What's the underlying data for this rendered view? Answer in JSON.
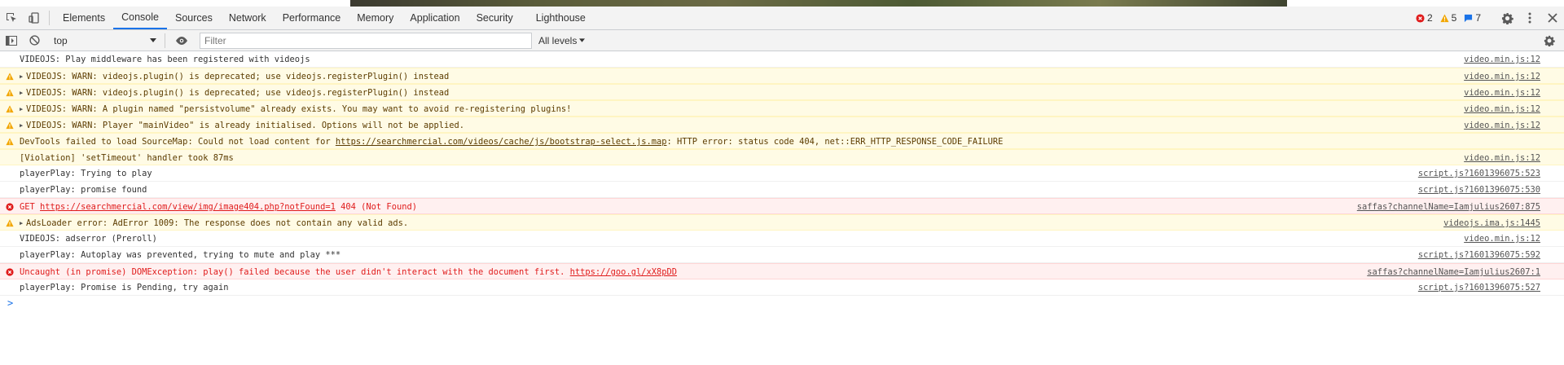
{
  "tabs": [
    {
      "label": "Elements",
      "active": false
    },
    {
      "label": "Console",
      "active": true
    },
    {
      "label": "Sources",
      "active": false
    },
    {
      "label": "Network",
      "active": false
    },
    {
      "label": "Performance",
      "active": false
    },
    {
      "label": "Memory",
      "active": false
    },
    {
      "label": "Application",
      "active": false
    },
    {
      "label": "Security",
      "active": false
    },
    {
      "label": "Lighthouse",
      "active": false
    }
  ],
  "counts": {
    "errors": "2",
    "warnings": "5",
    "messages": "7"
  },
  "toolbar": {
    "context": "top",
    "filter_placeholder": "Filter",
    "levels": "All levels"
  },
  "colors": {
    "accent": "#1a73e8",
    "warn_bg": "#fffbe5",
    "error_bg": "#fff0f0",
    "error_text": "#e01b1b",
    "warn_icon": "#f2a600"
  },
  "messages": [
    {
      "level": "info",
      "expandable": false,
      "text": "VIDEOJS: Play middleware has been registered with videojs",
      "link": "",
      "after": "",
      "source": "video.min.js:12"
    },
    {
      "level": "warn",
      "expandable": true,
      "text": "VIDEOJS: WARN: videojs.plugin() is deprecated; use videojs.registerPlugin() instead",
      "link": "",
      "after": "",
      "source": "video.min.js:12"
    },
    {
      "level": "warn",
      "expandable": true,
      "text": "VIDEOJS: WARN: videojs.plugin() is deprecated; use videojs.registerPlugin() instead",
      "link": "",
      "after": "",
      "source": "video.min.js:12"
    },
    {
      "level": "warn",
      "expandable": true,
      "text": "VIDEOJS: WARN: A plugin named \"persistvolume\" already exists. You may want to avoid re-registering plugins!",
      "link": "",
      "after": "",
      "source": "video.min.js:12"
    },
    {
      "level": "warn",
      "expandable": true,
      "text": "VIDEOJS: WARN: Player \"mainVideo\" is already initialised. Options will not be applied.",
      "link": "",
      "after": "",
      "source": "video.min.js:12"
    },
    {
      "level": "warn",
      "expandable": false,
      "text": "DevTools failed to load SourceMap: Could not load content for ",
      "link": "https://searchmercial.com/videos/cache/js/bootstrap-select.js.map",
      "after": ": HTTP error: status code 404, net::ERR_HTTP_RESPONSE_CODE_FAILURE",
      "source": ""
    },
    {
      "level": "violation",
      "expandable": false,
      "text": "[Violation] 'setTimeout' handler took 87ms",
      "link": "",
      "after": "",
      "source": "video.min.js:12"
    },
    {
      "level": "info",
      "expandable": false,
      "text": "playerPlay: Trying to play",
      "link": "",
      "after": "",
      "source": "script.js?1601396075:523"
    },
    {
      "level": "info",
      "expandable": false,
      "text": "playerPlay: promise found",
      "link": "",
      "after": "",
      "source": "script.js?1601396075:530"
    },
    {
      "level": "error",
      "expandable": false,
      "text": "GET ",
      "link": "https://searchmercial.com/view/img/image404.php?notFound=1",
      "after": " 404 (Not Found)",
      "source": "saffas?channelName=Iamjulius2607:875"
    },
    {
      "level": "warn",
      "expandable": true,
      "text": "AdsLoader error: AdError 1009: The response does not contain any valid ads.",
      "link": "",
      "after": "",
      "source": "videojs.ima.js:1445"
    },
    {
      "level": "info",
      "expandable": false,
      "text": "VIDEOJS: adserror (Preroll)",
      "link": "",
      "after": "",
      "source": "video.min.js:12"
    },
    {
      "level": "info",
      "expandable": false,
      "text": "playerPlay: Autoplay was prevented, trying to mute and play ***",
      "link": "",
      "after": "",
      "source": "script.js?1601396075:592"
    },
    {
      "level": "error",
      "expandable": false,
      "text": "Uncaught (in promise) DOMException: play() failed because the user didn't interact with the document first. ",
      "link": "https://goo.gl/xX8pDD",
      "after": "",
      "source": "saffas?channelName=Iamjulius2607:1"
    },
    {
      "level": "info",
      "expandable": false,
      "text": "playerPlay: Promise is Pending, try again",
      "link": "",
      "after": "",
      "source": "script.js?1601396075:527"
    }
  ],
  "prompt": ">"
}
